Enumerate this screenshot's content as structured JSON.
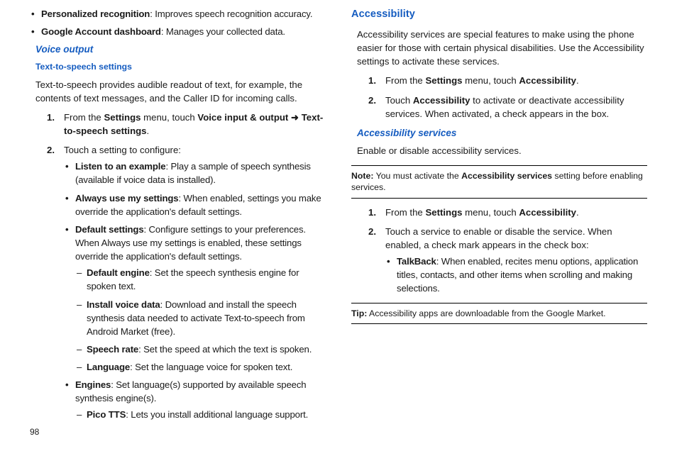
{
  "page_number": "98",
  "left": {
    "top_bullets": [
      {
        "term": "Personalized recognition",
        "desc": ": Improves speech recognition accuracy."
      },
      {
        "term": "Google Account dashboard",
        "desc": ": Manages your collected data."
      }
    ],
    "voice_output_heading": "Voice output",
    "tts_heading": "Text-to-speech settings",
    "tts_intro": "Text-to-speech provides audible readout of text, for example, the contents of text messages, and the Caller ID for incoming calls.",
    "steps": [
      {
        "pre": "From the ",
        "b1": "Settings",
        "mid": " menu, touch ",
        "b2": "Voice input & output",
        "arrow": " ➜ ",
        "b3": "Text-to-speech settings",
        "post": "."
      },
      {
        "text": "Touch a setting to configure:"
      }
    ],
    "config_bullets": [
      {
        "term": "Listen to an example",
        "desc": ": Play a sample of speech synthesis (available if voice data is installed)."
      },
      {
        "term": "Always use my settings",
        "desc": ": When enabled, settings you make override the application's default settings."
      },
      {
        "term": "Default settings",
        "desc": ": Configure settings to your preferences. When Always use my settings is enabled, these settings override the application's default settings.",
        "dashes": [
          {
            "term": "Default engine",
            "desc": ": Set the speech synthesis engine for spoken text."
          },
          {
            "term": "Install voice data",
            "desc": ": Download and install the speech synthesis data needed to activate Text-to-speech from Android Market (free)."
          },
          {
            "term": "Speech rate",
            "desc": ": Set the speed at which the text is spoken."
          },
          {
            "term": "Language",
            "desc": ": Set the language voice for spoken text."
          }
        ]
      },
      {
        "term": "Engines",
        "desc": ": Set language(s) supported by available speech synthesis engine(s).",
        "dashes": [
          {
            "term": "Pico TTS",
            "desc": ": Lets you install additional language support."
          }
        ]
      }
    ]
  },
  "right": {
    "accessibility_heading": "Accessibility",
    "intro": "Accessibility services are special features to make using the phone easier for those with certain physical disabilities. Use the Accessibility settings to activate these services.",
    "steps1": [
      {
        "pre": "From the ",
        "b1": "Settings",
        "mid": " menu, touch ",
        "b2": "Accessibility",
        "post": "."
      },
      {
        "pre": "Touch ",
        "b1": "Accessibility",
        "post": " to activate or deactivate accessibility services. When activated, a check appears in the box."
      }
    ],
    "services_heading": "Accessibility services",
    "services_intro": "Enable or disable accessibility services.",
    "note_label": "Note:",
    "note_pre": " You must activate the ",
    "note_bold": "Accessibility services",
    "note_post": " setting before enabling services.",
    "steps2": [
      {
        "pre": "From the ",
        "b1": "Settings",
        "mid": " menu, touch ",
        "b2": "Accessibility",
        "post": "."
      },
      {
        "text": "Touch a service to enable or disable the service. When enabled, a check mark appears in the check box:"
      }
    ],
    "talkback": {
      "term": "TalkBack",
      "desc": ": When enabled, recites menu options, application titles, contacts, and other items when scrolling and making selections."
    },
    "tip_label": "Tip:",
    "tip_text": " Accessibility apps are downloadable from the Google Market."
  }
}
